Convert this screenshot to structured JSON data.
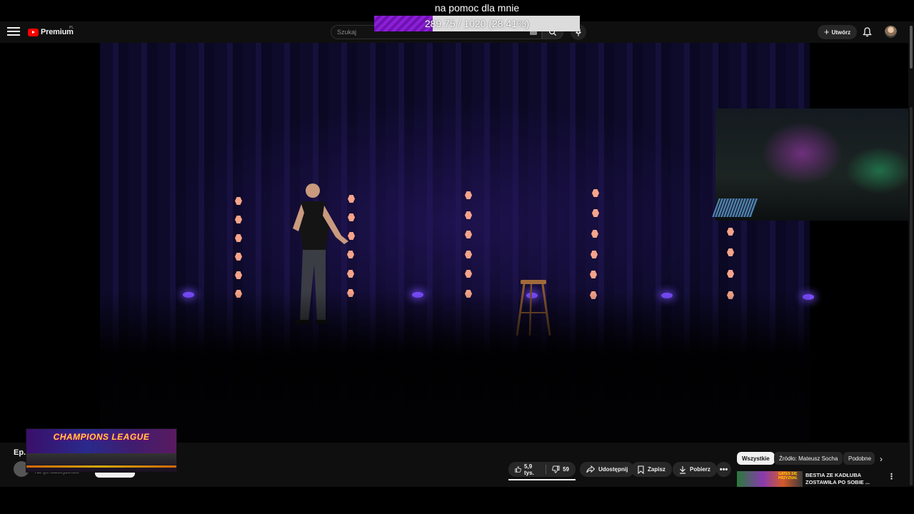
{
  "overlay": {
    "title": "na pomoc dla mnie",
    "progress_text": "289.75 / 1020 (28.41%)",
    "current": 289.75,
    "goal": 1020,
    "percent": 28.41,
    "fill_color": "#8d1fd6"
  },
  "header": {
    "logo_text": "Premium",
    "region": "PL",
    "search_placeholder": "Szukaj",
    "create_label": "Utwórz",
    "brand_color": "#ff0000"
  },
  "video": {
    "title": "Ep.",
    "channel_subscribers": "718 tys. subskrybentów"
  },
  "promo": {
    "text": "CHAMPIONS LEAGUE"
  },
  "actions": {
    "likes": "5,9 tys.",
    "dislikes": "59",
    "share": "Udostępnij",
    "save": "Zapisz",
    "download": "Pobierz",
    "more": "•••"
  },
  "chips": [
    {
      "label": "Wszystkie",
      "active": true
    },
    {
      "label": "Źródło: Mateusz Socha",
      "active": false
    },
    {
      "label": "Podobne",
      "active": false
    }
  ],
  "recommendation": {
    "badge": "GATES SIĘ PRZYZNAŁ",
    "title": "BESTIA ZE KADŁUBA ZOSTAWIŁA PO SOBIE ..."
  },
  "icons": {
    "menu": "menu-icon",
    "search": "search-icon",
    "mic": "mic-icon",
    "bell": "bell-icon",
    "like": "thumb-up-icon",
    "dislike": "thumb-down-icon",
    "share": "share-icon",
    "save": "bookmark-icon",
    "download": "download-icon"
  }
}
